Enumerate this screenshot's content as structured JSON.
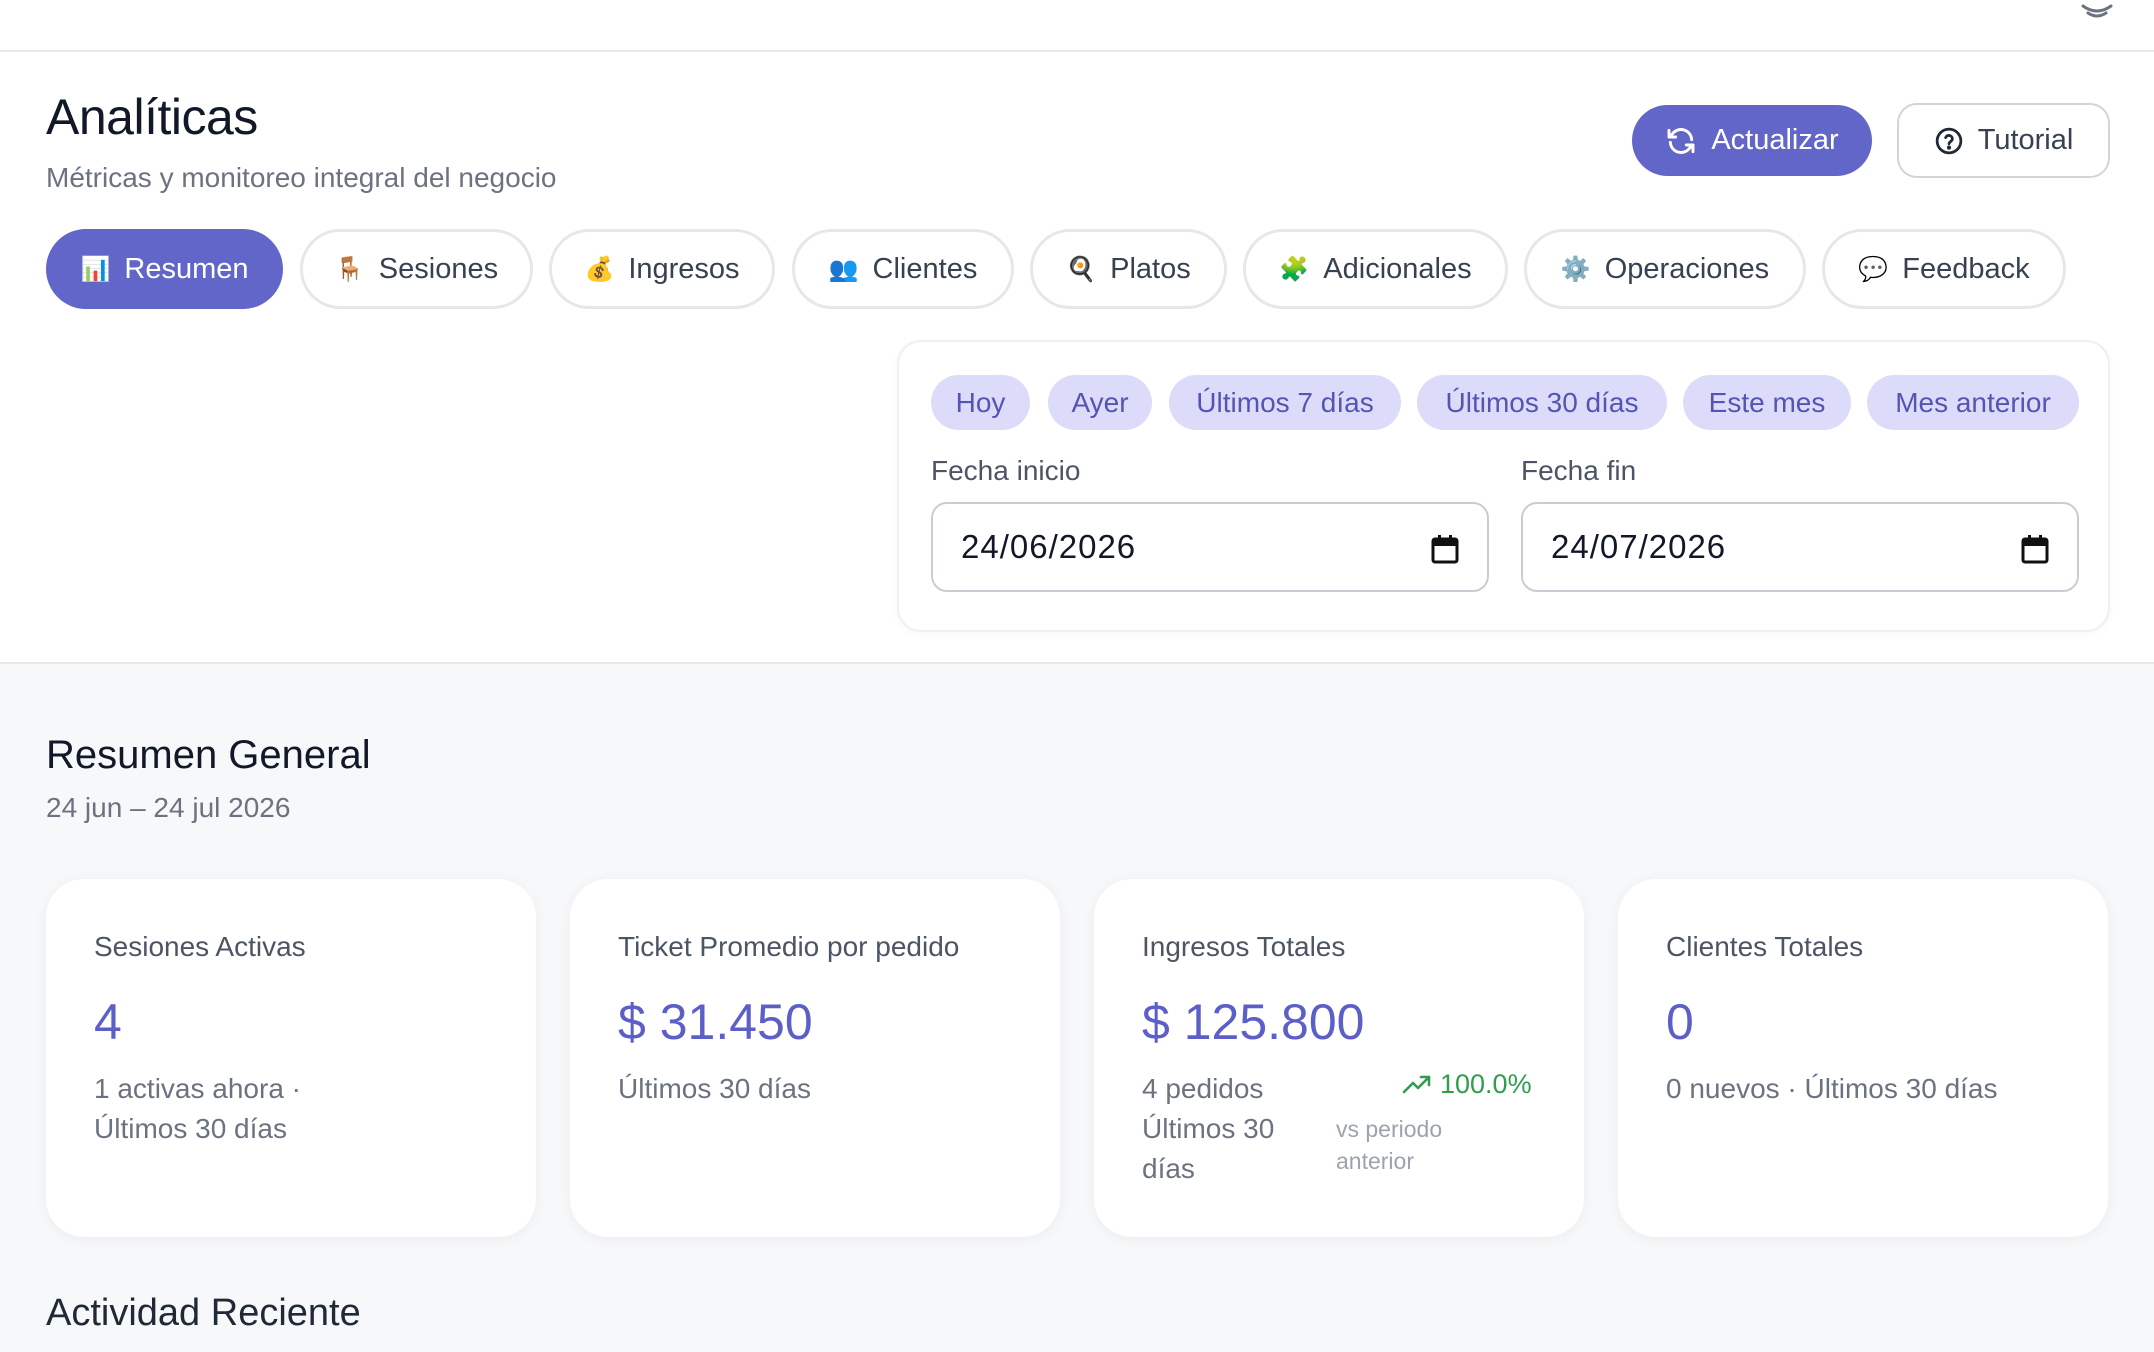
{
  "topbar": {
    "icon": "cloud-icon"
  },
  "header": {
    "title": "Analíticas",
    "subtitle": "Métricas y monitoreo integral del negocio",
    "refresh_label": "Actualizar",
    "tutorial_label": "Tutorial"
  },
  "tabs": [
    {
      "label": "Resumen",
      "icon": "📊",
      "active": true
    },
    {
      "label": "Sesiones",
      "icon": "🪑"
    },
    {
      "label": "Ingresos",
      "icon": "💰"
    },
    {
      "label": "Clientes",
      "icon": "👥"
    },
    {
      "label": "Platos",
      "icon": "🍳"
    },
    {
      "label": "Adicionales",
      "icon": "🧩"
    },
    {
      "label": "Operaciones",
      "icon": "⚙️"
    },
    {
      "label": "Feedback",
      "icon": "💬"
    }
  ],
  "date_filter": {
    "presets": [
      "Hoy",
      "Ayer",
      "Últimos 7 días",
      "Últimos 30 días",
      "Este mes",
      "Mes anterior"
    ],
    "start_label": "Fecha inicio",
    "start_value": "24/06/2026",
    "end_label": "Fecha fin",
    "end_value": "24/07/2026"
  },
  "summary": {
    "title": "Resumen General",
    "range": "24 jun – 24 jul 2026",
    "cards": [
      {
        "label": "Sesiones Activas",
        "value": "4",
        "note_line1": "1 activas ahora ·",
        "note_line2": "Últimos 30 días"
      },
      {
        "label": "Ticket Promedio por pedido",
        "value": "$ 31.450",
        "note_line1": "Últimos 30 días"
      },
      {
        "label": "Ingresos Totales",
        "value": "$ 125.800",
        "note_line1": "4 pedidos",
        "note_line2": "Últimos 30",
        "note_line3": "días",
        "trend": "100.0%",
        "trend_sub": "vs periodo anterior"
      },
      {
        "label": "Clientes Totales",
        "value": "0",
        "note_line1": "0 nuevos · Últimos 30 días"
      }
    ]
  },
  "recent": {
    "title": "Actividad Reciente"
  },
  "colors": {
    "accent": "#6366c9",
    "chip_bg": "#dcdcfa",
    "trend_up": "#2f9e4f"
  }
}
